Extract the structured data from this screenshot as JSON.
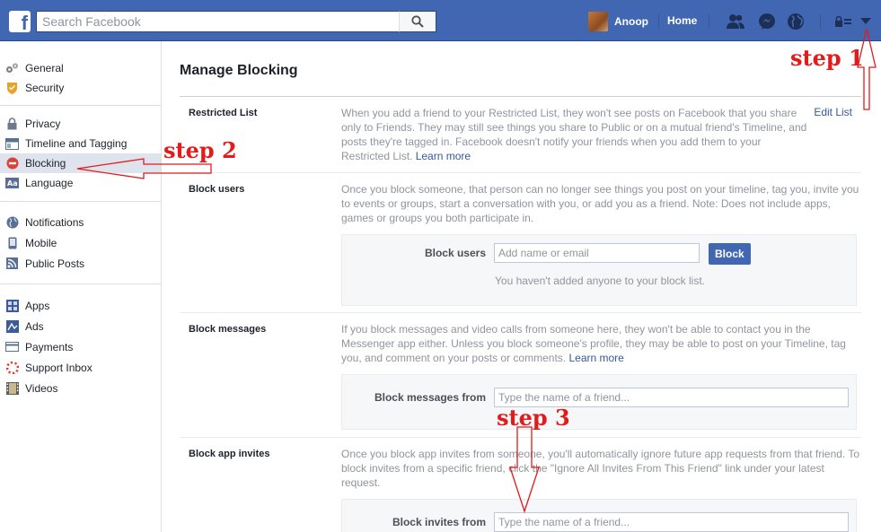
{
  "topbar": {
    "logo": "f",
    "search_placeholder": "Search Facebook",
    "user_name": "Anoop",
    "home_label": "Home"
  },
  "leftnav": {
    "groups": [
      [
        {
          "label": "General",
          "icon": "gear-icon"
        },
        {
          "label": "Security",
          "icon": "shield-icon"
        }
      ],
      [
        {
          "label": "Privacy",
          "icon": "lock-icon"
        },
        {
          "label": "Timeline and Tagging",
          "icon": "timeline-icon"
        },
        {
          "label": "Blocking",
          "icon": "blocking-icon",
          "active": true
        },
        {
          "label": "Language",
          "icon": "language-icon"
        }
      ],
      [
        {
          "label": "Notifications",
          "icon": "globe-icon"
        },
        {
          "label": "Mobile",
          "icon": "mobile-icon"
        },
        {
          "label": "Public Posts",
          "icon": "rss-icon"
        }
      ],
      [
        {
          "label": "Apps",
          "icon": "apps-icon"
        },
        {
          "label": "Ads",
          "icon": "ads-icon"
        },
        {
          "label": "Payments",
          "icon": "payments-icon"
        },
        {
          "label": "Support Inbox",
          "icon": "lifebuoy-icon"
        },
        {
          "label": "Videos",
          "icon": "film-icon"
        }
      ]
    ]
  },
  "main": {
    "title": "Manage Blocking",
    "restricted": {
      "label": "Restricted List",
      "desc": "When you add a friend to your Restricted List, they won't see posts on Facebook that you share only to Friends. They may still see things you share to Public or on a mutual friend's Timeline, and posts they're tagged in. Facebook doesn't notify your friends when you add them to your Restricted List.",
      "learn_more": "Learn more",
      "edit": "Edit List"
    },
    "block_users": {
      "label": "Block users",
      "desc": "Once you block someone, that person can no longer see things you post on your timeline, tag you, invite you to events or groups, start a conversation with you, or add you as a friend. Note: Does not include apps, games or groups you both participate in.",
      "field_label": "Block users",
      "placeholder": "Add name or email",
      "button": "Block",
      "empty": "You haven't added anyone to your block list."
    },
    "block_messages": {
      "label": "Block messages",
      "desc": "If you block messages and video calls from someone here, they won't be able to contact you in the Messenger app either. Unless you block someone's profile, they may be able to post on your Timeline, tag you, and comment on your posts or comments.",
      "learn_more": "Learn more",
      "field_label": "Block messages from",
      "placeholder": "Type the name of a friend..."
    },
    "block_app_invites": {
      "label": "Block app invites",
      "desc": "Once you block app invites from someone, you'll automatically ignore future app requests from that friend. To block invites from a specific friend, click the \"Ignore All Invites From This Friend\" link under your latest request.",
      "field_label": "Block invites from",
      "placeholder": "Type the name of a friend..."
    }
  },
  "annotations": {
    "step1": "step 1",
    "step2": "step 2",
    "step3": "step 3",
    "color": "#e21b1b"
  }
}
